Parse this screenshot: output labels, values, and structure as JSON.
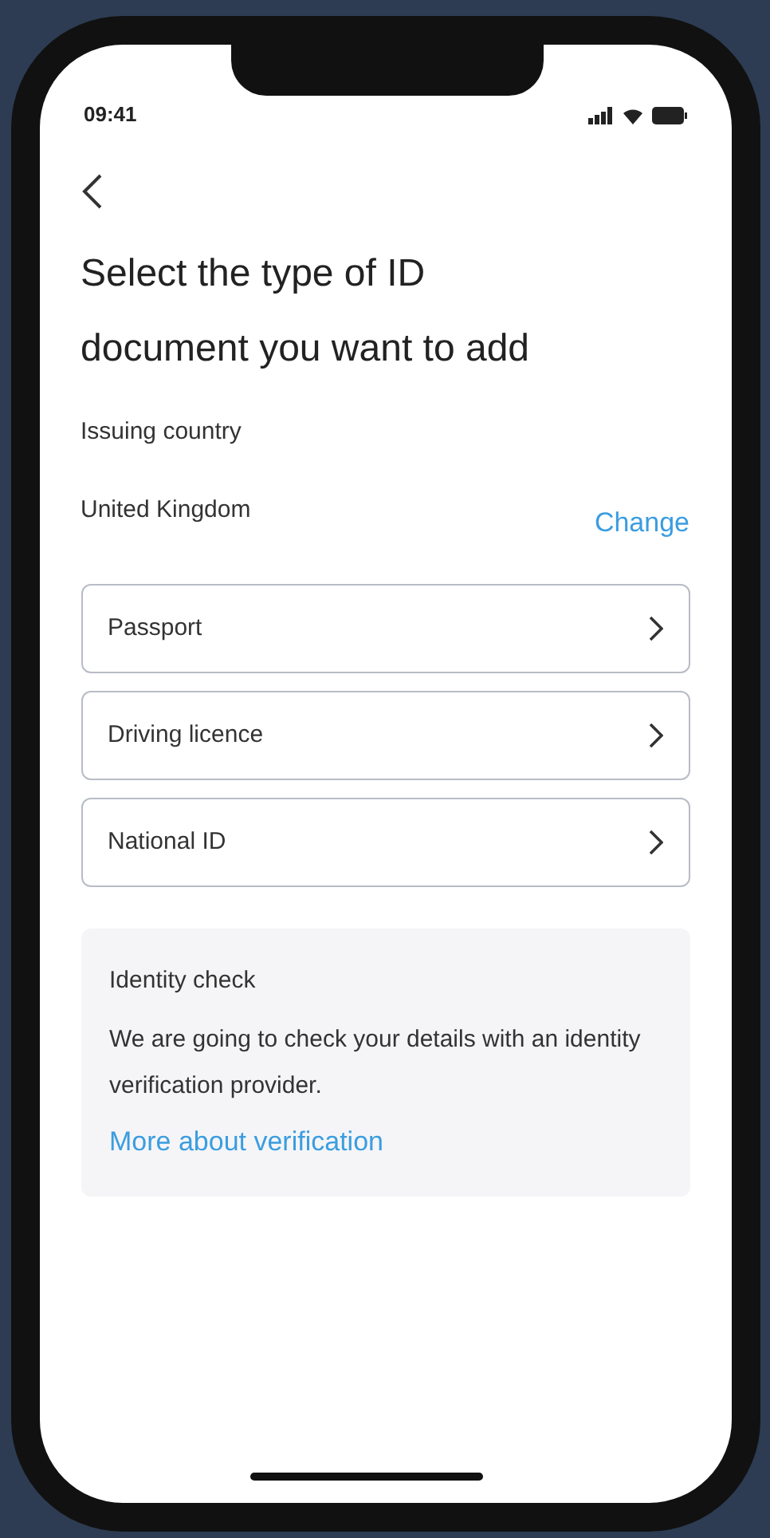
{
  "status_bar": {
    "time": "09:41"
  },
  "title": "Select the type of ID document you want to add",
  "issuing_country": {
    "label": "Issuing country",
    "value": "United Kingdom",
    "action": "Change"
  },
  "document_types": [
    {
      "label": "Passport"
    },
    {
      "label": "Driving licence"
    },
    {
      "label": "National ID"
    }
  ],
  "info_panel": {
    "title": "Identity check",
    "text": "We are going to check your details with an identity verification provider.",
    "link": "More about verification"
  }
}
